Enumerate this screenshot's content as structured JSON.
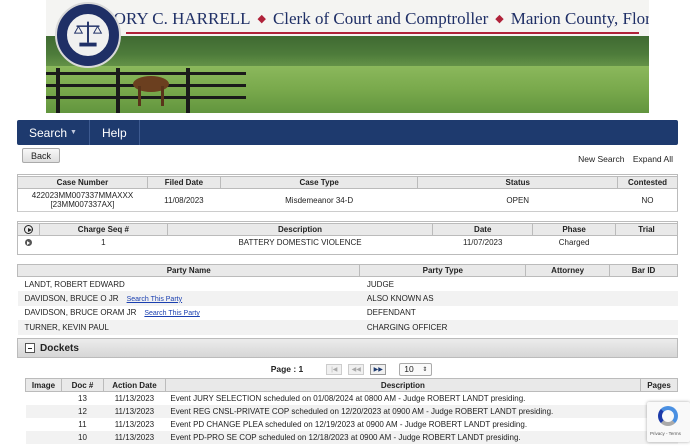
{
  "banner": {
    "name": "GREGORY C. HARRELL",
    "office": "Clerk of Court and Comptroller",
    "county": "Marion County, Florida",
    "seal_top": "CLERK OF COURT AND COMPTROLLER",
    "seal_bottom": "MARION COUNTY, FLORIDA"
  },
  "nav": {
    "search": "Search",
    "help": "Help"
  },
  "actions": {
    "back": "Back",
    "new_search": "New Search",
    "expand_all": "Expand All"
  },
  "case": {
    "headers": [
      "Case Number",
      "Filed Date",
      "Case Type",
      "Status",
      "Contested"
    ],
    "case_number": "422023MM007337MMAXXX",
    "case_number_alt": "[23MM007337AX]",
    "filed_date": "11/08/2023",
    "case_type": "Misdemeanor 34-D",
    "status": "OPEN",
    "contested": "NO"
  },
  "charges": {
    "headers": [
      "Charge Seq #",
      "Description",
      "Date",
      "Phase",
      "Trial"
    ],
    "rows": [
      {
        "seq": "1",
        "description": "BATTERY DOMESTIC VIOLENCE",
        "date": "11/07/2023",
        "phase": "Charged",
        "trial": ""
      }
    ]
  },
  "parties": {
    "headers": [
      "Party Name",
      "Party Type",
      "Attorney",
      "Bar ID"
    ],
    "search_link": "Search This Party",
    "rows": [
      {
        "name": "LANDT, ROBERT EDWARD",
        "type": "JUDGE"
      },
      {
        "name": "DAVIDSON, BRUCE O JR",
        "type": "ALSO KNOWN AS"
      },
      {
        "name": "DAVIDSON, BRUCE ORAM JR",
        "type": "DEFENDANT"
      },
      {
        "name": "TURNER, KEVIN PAUL",
        "type": "CHARGING OFFICER"
      }
    ]
  },
  "dockets": {
    "title": "Dockets",
    "page_label": "Page : 1",
    "page_size": "10",
    "headers": [
      "Image",
      "Doc #",
      "Action Date",
      "Description",
      "Pages"
    ],
    "rows": [
      {
        "doc": "13",
        "date": "11/13/2023",
        "description": "Event JURY SELECTION scheduled on 01/08/2024 at 0800 AM - Judge ROBERT LANDT presiding.",
        "pages": ""
      },
      {
        "doc": "12",
        "date": "11/13/2023",
        "description": "Event REG CNSL-PRIVATE COP scheduled on 12/20/2023 at 0900 AM - Judge ROBERT LANDT presiding.",
        "pages": ""
      },
      {
        "doc": "11",
        "date": "11/13/2023",
        "description": "Event PD CHANGE PLEA scheduled on 12/19/2023 at 0900 AM - Judge ROBERT LANDT presiding.",
        "pages": ""
      },
      {
        "doc": "10",
        "date": "11/13/2023",
        "description": "Event PD-PRO SE COP scheduled on 12/18/2023 at 0900 AM - Judge ROBERT LANDT presiding.",
        "pages": ""
      }
    ]
  },
  "recaptcha": {
    "links": "Privacy - Terms"
  }
}
